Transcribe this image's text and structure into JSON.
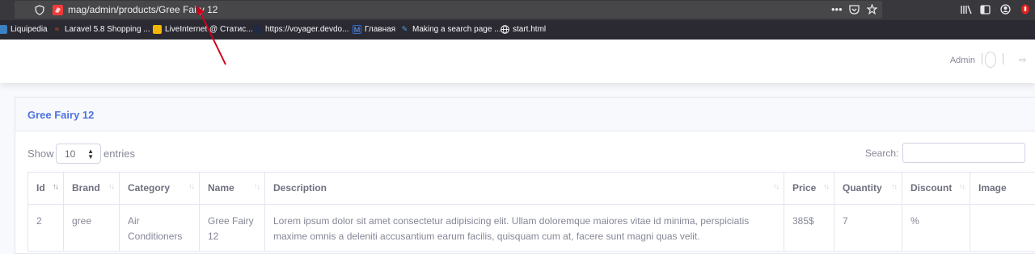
{
  "browser": {
    "url": "mag/admin/products/Gree Fairy 12",
    "url_actions": [
      "•••",
      "pocket-icon",
      "star-icon"
    ],
    "bookmarks": [
      {
        "label": "Liquipedia",
        "icon": "liquipedia-icon",
        "color": "#3b82c4"
      },
      {
        "label": "Laravel 5.8 Shopping ...",
        "icon": "laravel-icon",
        "color": "#f4511e"
      },
      {
        "label": "LiveInternet @ Статис...",
        "icon": "liveinternet-icon",
        "color": "#f2b705"
      },
      {
        "label": "https://voyager.devdo...",
        "icon": "voyager-icon",
        "color": "#1f2a44"
      },
      {
        "label": "Главная",
        "icon": "m-icon",
        "color": "#2f6fd6"
      },
      {
        "label": "Making a search page ...",
        "icon": "pen-icon",
        "color": "#4aa3df"
      },
      {
        "label": "start.html",
        "icon": "globe-icon",
        "color": "#fbfbfe"
      }
    ]
  },
  "header": {
    "user_name": "Admin"
  },
  "card": {
    "title": "Gree Fairy 12"
  },
  "datatable": {
    "show_label": "Show",
    "entries_label": "entries",
    "page_length": "10",
    "search_label": "Search:",
    "search_value": "",
    "columns": [
      "Id",
      "Brand",
      "Category",
      "Name",
      "Description",
      "Price",
      "Quantity",
      "Discount",
      "Image"
    ],
    "sorted_column": "Id",
    "rows": [
      {
        "id": "2",
        "brand": "gree",
        "category": "Air Conditioners",
        "name": "Gree Fairy 12",
        "description": "Lorem ipsum dolor sit amet consectetur adipisicing elit. Ullam doloremque maiores vitae id minima, perspiciatis maxime omnis a deleniti accusantium earum facilis, quisquam cum at, facere sunt magni quas velit.",
        "price": "385$",
        "quantity": "7",
        "discount": "%",
        "image": ""
      }
    ]
  },
  "colors": {
    "accent": "#4e73df",
    "annotation_arrow": "#d0021b"
  }
}
